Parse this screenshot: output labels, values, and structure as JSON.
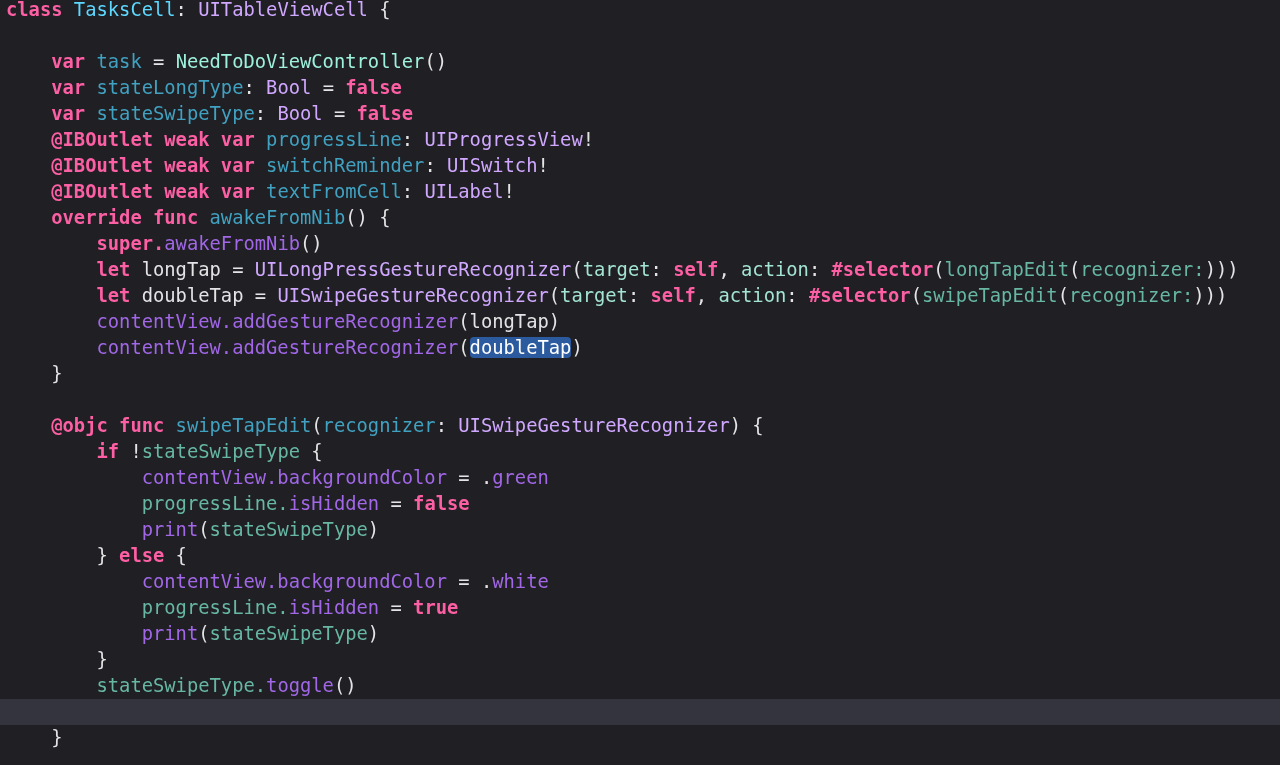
{
  "editor": {
    "lines": [
      {
        "current": false,
        "tokens": [
          {
            "kind": "keyword",
            "text": "class "
          },
          {
            "kind": "decltype",
            "text": "TasksCell"
          },
          {
            "kind": "plain",
            "text": ": "
          },
          {
            "kind": "systype",
            "text": "UITableViewCell"
          },
          {
            "kind": "plain",
            "text": " {"
          }
        ]
      },
      {
        "current": false
      },
      {
        "current": false,
        "tokens": [
          {
            "kind": "keyword",
            "text": "    var "
          },
          {
            "kind": "decl",
            "text": "task"
          },
          {
            "kind": "plain",
            "text": " = "
          },
          {
            "kind": "projtype",
            "text": "NeedToDoViewController"
          },
          {
            "kind": "plain",
            "text": "()"
          }
        ]
      },
      {
        "current": false,
        "tokens": [
          {
            "kind": "keyword",
            "text": "    var "
          },
          {
            "kind": "decl",
            "text": "stateLongType"
          },
          {
            "kind": "plain",
            "text": ": "
          },
          {
            "kind": "systype",
            "text": "Bool"
          },
          {
            "kind": "plain",
            "text": " = "
          },
          {
            "kind": "keyword",
            "text": "false"
          }
        ]
      },
      {
        "current": false,
        "tokens": [
          {
            "kind": "keyword",
            "text": "    var "
          },
          {
            "kind": "decl",
            "text": "stateSwipeType"
          },
          {
            "kind": "plain",
            "text": ": "
          },
          {
            "kind": "systype",
            "text": "Bool"
          },
          {
            "kind": "plain",
            "text": " = "
          },
          {
            "kind": "keyword",
            "text": "false"
          }
        ]
      },
      {
        "current": false,
        "tokens": [
          {
            "kind": "keyword",
            "text": "    @IBOutlet weak var "
          },
          {
            "kind": "decl",
            "text": "progressLine"
          },
          {
            "kind": "plain",
            "text": ": "
          },
          {
            "kind": "systype",
            "text": "UIProgressView"
          },
          {
            "kind": "plain",
            "text": "!"
          }
        ]
      },
      {
        "current": false,
        "tokens": [
          {
            "kind": "keyword",
            "text": "    @IBOutlet weak var "
          },
          {
            "kind": "decl",
            "text": "switchReminder"
          },
          {
            "kind": "plain",
            "text": ": "
          },
          {
            "kind": "systype",
            "text": "UISwitch"
          },
          {
            "kind": "plain",
            "text": "!"
          }
        ]
      },
      {
        "current": false,
        "tokens": [
          {
            "kind": "keyword",
            "text": "    @IBOutlet weak var "
          },
          {
            "kind": "decl",
            "text": "textFromCell"
          },
          {
            "kind": "plain",
            "text": ": "
          },
          {
            "kind": "systype",
            "text": "UILabel"
          },
          {
            "kind": "plain",
            "text": "!"
          }
        ]
      },
      {
        "current": false,
        "tokens": [
          {
            "kind": "keyword",
            "text": "    override func "
          },
          {
            "kind": "decl",
            "text": "awakeFromNib"
          },
          {
            "kind": "plain",
            "text": "() {"
          }
        ]
      },
      {
        "current": false,
        "tokens": [
          {
            "kind": "keyword",
            "text": "        super."
          },
          {
            "kind": "sysmember",
            "text": "awakeFromNib"
          },
          {
            "kind": "plain",
            "text": "()"
          }
        ]
      },
      {
        "current": false,
        "tokens": [
          {
            "kind": "keyword",
            "text": "        let"
          },
          {
            "kind": "plain",
            "text": " longTap = "
          },
          {
            "kind": "systype",
            "text": "UILongPressGestureRecognizer"
          },
          {
            "kind": "plain",
            "text": "("
          },
          {
            "kind": "arglabel",
            "text": "target"
          },
          {
            "kind": "plain",
            "text": ": "
          },
          {
            "kind": "keyword",
            "text": "self"
          },
          {
            "kind": "plain",
            "text": ", "
          },
          {
            "kind": "arglabel",
            "text": "action"
          },
          {
            "kind": "plain",
            "text": ": "
          },
          {
            "kind": "keyword",
            "text": "#selector"
          },
          {
            "kind": "plain",
            "text": "("
          },
          {
            "kind": "projmember",
            "text": "longTapEdit"
          },
          {
            "kind": "plain",
            "text": "("
          },
          {
            "kind": "projmember",
            "text": "recognizer:"
          },
          {
            "kind": "plain",
            "text": ")))"
          }
        ]
      },
      {
        "current": false,
        "tokens": [
          {
            "kind": "keyword",
            "text": "        let"
          },
          {
            "kind": "plain",
            "text": " doubleTap = "
          },
          {
            "kind": "systype",
            "text": "UISwipeGestureRecognizer"
          },
          {
            "kind": "plain",
            "text": "("
          },
          {
            "kind": "arglabel",
            "text": "target"
          },
          {
            "kind": "plain",
            "text": ": "
          },
          {
            "kind": "keyword",
            "text": "self"
          },
          {
            "kind": "plain",
            "text": ", "
          },
          {
            "kind": "arglabel",
            "text": "action"
          },
          {
            "kind": "plain",
            "text": ": "
          },
          {
            "kind": "keyword",
            "text": "#selector"
          },
          {
            "kind": "plain",
            "text": "("
          },
          {
            "kind": "projmember",
            "text": "swipeTapEdit"
          },
          {
            "kind": "plain",
            "text": "("
          },
          {
            "kind": "projmember",
            "text": "recognizer:"
          },
          {
            "kind": "plain",
            "text": ")))"
          }
        ]
      },
      {
        "current": false,
        "tokens": [
          {
            "kind": "sysmember",
            "text": "        contentView.addGestureRecognizer"
          },
          {
            "kind": "plain",
            "text": "(longTap)"
          }
        ]
      },
      {
        "current": false,
        "tokens": [
          {
            "kind": "sysmember",
            "text": "        contentView.addGestureRecognizer",
            "selected": false
          },
          {
            "kind": "plain",
            "text": "(",
            "selected": false
          },
          {
            "kind": "plain",
            "text": "doubleTap",
            "selected": true
          },
          {
            "kind": "plain",
            "text": ")",
            "selected": false
          }
        ]
      },
      {
        "current": false,
        "tokens": [
          {
            "kind": "plain",
            "text": "    }"
          }
        ]
      },
      {
        "current": false
      },
      {
        "current": false,
        "tokens": [
          {
            "kind": "keyword",
            "text": "    @objc func "
          },
          {
            "kind": "decl",
            "text": "swipeTapEdit"
          },
          {
            "kind": "plain",
            "text": "("
          },
          {
            "kind": "decl",
            "text": "recognizer"
          },
          {
            "kind": "plain",
            "text": ": "
          },
          {
            "kind": "systype",
            "text": "UISwipeGestureRecognizer"
          },
          {
            "kind": "plain",
            "text": ") {"
          }
        ]
      },
      {
        "current": false,
        "tokens": [
          {
            "kind": "keyword",
            "text": "        if"
          },
          {
            "kind": "plain",
            "text": " !"
          },
          {
            "kind": "projmember",
            "text": "stateSwipeType"
          },
          {
            "kind": "plain",
            "text": " {"
          }
        ]
      },
      {
        "current": false,
        "tokens": [
          {
            "kind": "sysmember",
            "text": "            contentView.backgroundColor"
          },
          {
            "kind": "plain",
            "text": " = ."
          },
          {
            "kind": "sysmember",
            "text": "green"
          }
        ]
      },
      {
        "current": false,
        "tokens": [
          {
            "kind": "projmember",
            "text": "            progressLine."
          },
          {
            "kind": "sysmember",
            "text": "isHidden"
          },
          {
            "kind": "plain",
            "text": " = "
          },
          {
            "kind": "keyword",
            "text": "false"
          }
        ]
      },
      {
        "current": false,
        "tokens": [
          {
            "kind": "sysmember",
            "text": "            print"
          },
          {
            "kind": "plain",
            "text": "("
          },
          {
            "kind": "projmember",
            "text": "stateSwipeType"
          },
          {
            "kind": "plain",
            "text": ")"
          }
        ]
      },
      {
        "current": false,
        "tokens": [
          {
            "kind": "plain",
            "text": "        } "
          },
          {
            "kind": "keyword",
            "text": "else"
          },
          {
            "kind": "plain",
            "text": " {"
          }
        ]
      },
      {
        "current": false,
        "tokens": [
          {
            "kind": "sysmember",
            "text": "            contentView.backgroundColor"
          },
          {
            "kind": "plain",
            "text": " = ."
          },
          {
            "kind": "sysmember",
            "text": "white"
          }
        ]
      },
      {
        "current": false,
        "tokens": [
          {
            "kind": "projmember",
            "text": "            progressLine."
          },
          {
            "kind": "sysmember",
            "text": "isHidden"
          },
          {
            "kind": "plain",
            "text": " = "
          },
          {
            "kind": "keyword",
            "text": "true"
          }
        ]
      },
      {
        "current": false,
        "tokens": [
          {
            "kind": "sysmember",
            "text": "            print"
          },
          {
            "kind": "plain",
            "text": "("
          },
          {
            "kind": "projmember",
            "text": "stateSwipeType"
          },
          {
            "kind": "plain",
            "text": ")"
          }
        ]
      },
      {
        "current": false,
        "tokens": [
          {
            "kind": "plain",
            "text": "        }"
          }
        ]
      },
      {
        "current": false,
        "tokens": [
          {
            "kind": "projmember",
            "text": "        stateSwipeType."
          },
          {
            "kind": "sysmember",
            "text": "toggle"
          },
          {
            "kind": "plain",
            "text": "()"
          }
        ]
      },
      {
        "current": true
      },
      {
        "current": false,
        "tokens": [
          {
            "kind": "plain",
            "text": "    }"
          }
        ]
      }
    ]
  }
}
